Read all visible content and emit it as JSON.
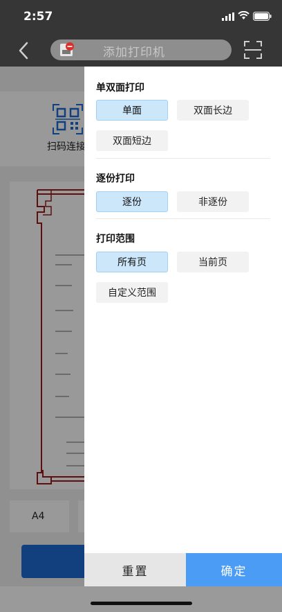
{
  "status_bar": {
    "time": "2:57"
  },
  "nav": {
    "search_placeholder": "添加打印机"
  },
  "background": {
    "scan_label": "扫码连接",
    "paper_size": "A4"
  },
  "drawer": {
    "sections": [
      {
        "title": "单双面打印",
        "options": [
          {
            "label": "单面",
            "selected": true
          },
          {
            "label": "双面长边",
            "selected": false
          },
          {
            "label": "双面短边",
            "selected": false
          }
        ]
      },
      {
        "title": "逐份打印",
        "options": [
          {
            "label": "逐份",
            "selected": true
          },
          {
            "label": "非逐份",
            "selected": false
          }
        ]
      },
      {
        "title": "打印范围",
        "options": [
          {
            "label": "所有页",
            "selected": true
          },
          {
            "label": "当前页",
            "selected": false
          },
          {
            "label": "自定义范围",
            "selected": false
          }
        ]
      }
    ],
    "reset_label": "重置",
    "confirm_label": "确定"
  },
  "colors": {
    "accent": "#4a9cf4",
    "selected_bg": "#cce7fa",
    "dark_bar": "#363636"
  },
  "icons": [
    "back-icon",
    "printer-icon",
    "scan-icon",
    "qr-code-icon",
    "signal-icon",
    "wifi-icon",
    "battery-icon"
  ]
}
